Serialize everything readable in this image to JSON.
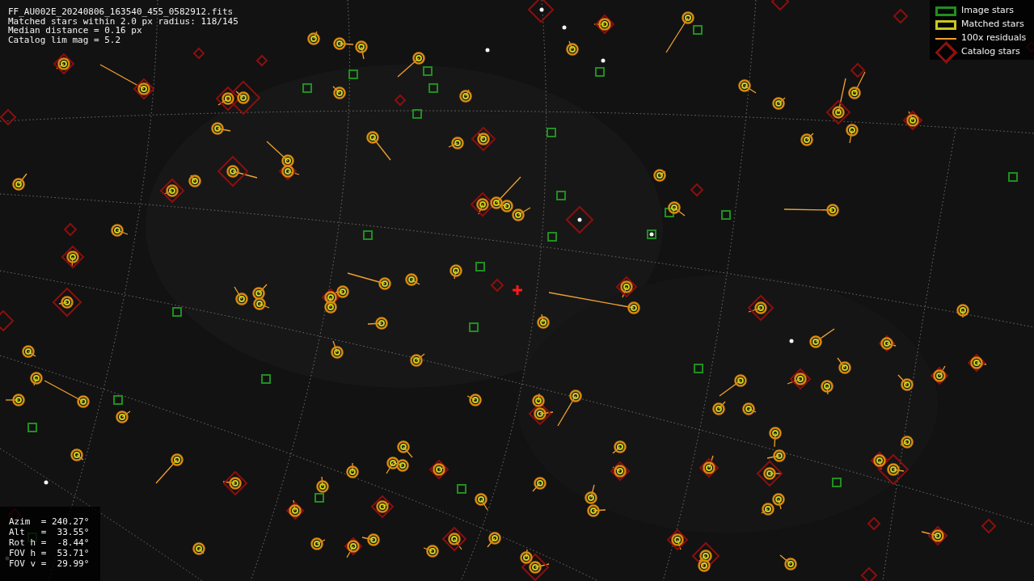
{
  "header": {
    "lines": [
      "FF_AU002E_20240806_163540_455_0582912.fits",
      "Matched stars within 2.0 px radius: 118/145",
      "Median distance = 0.16 px",
      "Catalog lim mag = 5.2"
    ]
  },
  "legend": [
    {
      "kind": "image",
      "label": "Image stars",
      "color": "#1f8f1f"
    },
    {
      "kind": "matched",
      "label": "Matched stars",
      "color": "#c8c81e"
    },
    {
      "kind": "residual",
      "label": "100x residuals",
      "color": "#f0a030"
    },
    {
      "kind": "catalog",
      "label": "Catalog stars",
      "color": "#8b0f0f"
    }
  ],
  "pointing": {
    "lines": [
      "Azim  = 240.27°",
      "Alt   =  33.55°",
      "Rot h =  -8.44°",
      "FOV h =  53.71°",
      "FOV v =  29.99°"
    ]
  }
}
